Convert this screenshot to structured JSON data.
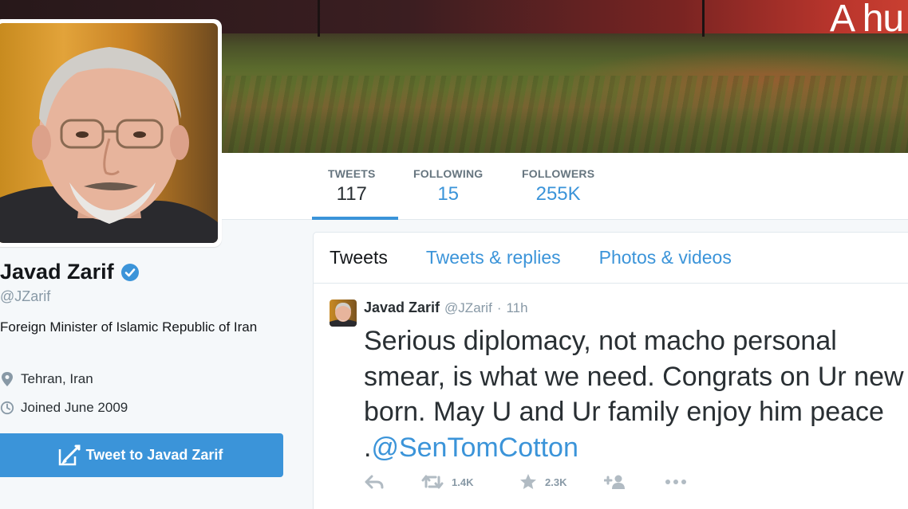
{
  "banner": {
    "text": "A hu"
  },
  "profile": {
    "name": "Javad Zarif",
    "handle": "@JZarif",
    "bio": "Foreign Minister of Islamic Republic of Iran",
    "location": "Tehran, Iran",
    "joined": "Joined June 2009",
    "tweet_to_label": "Tweet to Javad Zarif"
  },
  "stats": [
    {
      "label": "TWEETS",
      "value": "117"
    },
    {
      "label": "FOLLOWING",
      "value": "15"
    },
    {
      "label": "FOLLOWERS",
      "value": "255K"
    }
  ],
  "tabs": [
    "Tweets",
    "Tweets & replies",
    "Photos & videos"
  ],
  "tweet": {
    "name": "Javad Zarif",
    "handle": "@JZarif",
    "dot": "·",
    "time": "11h",
    "text": "Serious diplomacy, not macho personal smear, is what we need. Congrats on Ur new born. May U and Ur family enjoy him peace .",
    "mention": "@SenTomCotton",
    "retweets": "1.4K",
    "favorites": "2.3K"
  },
  "icons": [
    "verified-icon",
    "location-pin-icon",
    "clock-icon",
    "compose-icon",
    "reply-icon",
    "retweet-icon",
    "star-icon",
    "follow-icon",
    "more-icon"
  ],
  "colors": {
    "accent": "#3b94d9",
    "text": "#292f33",
    "muted": "#8899a6"
  }
}
